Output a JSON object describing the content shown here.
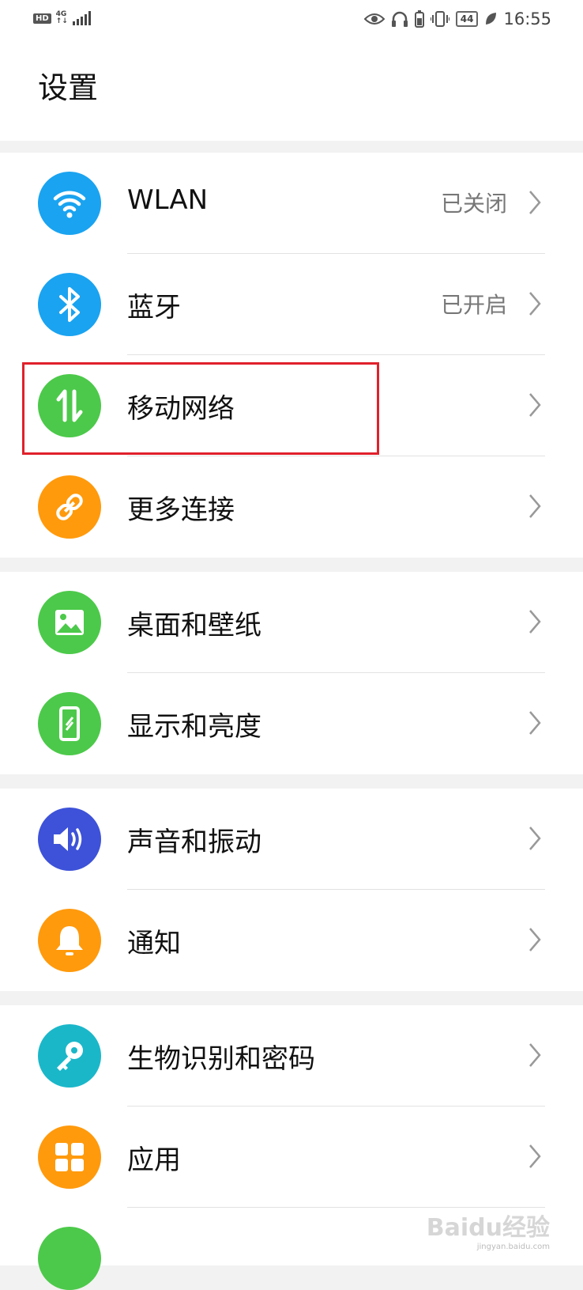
{
  "status_bar": {
    "hd_label": "HD",
    "network_label": "4G",
    "network_sub": "↑↓",
    "battery_level": "44",
    "time": "16:55"
  },
  "header": {
    "title": "设置"
  },
  "colors": {
    "wlan": "#1aa3f0",
    "bluetooth": "#1aa3f0",
    "mobile_network": "#4cc94a",
    "more_connections": "#ff9a0c",
    "wallpaper": "#4cc94a",
    "display": "#4cc94a",
    "sound": "#3d52d8",
    "notifications": "#ff9a0c",
    "biometrics": "#1ab7c9",
    "apps": "#ff9a0c",
    "highlight_box": "#e0212b"
  },
  "groups": [
    {
      "items": [
        {
          "label": "WLAN",
          "value": "已关闭",
          "icon": "wifi-icon"
        },
        {
          "label": "蓝牙",
          "value": "已开启",
          "icon": "bluetooth-icon"
        },
        {
          "label": "移动网络",
          "value": "",
          "icon": "mobile-data-icon"
        },
        {
          "label": "更多连接",
          "value": "",
          "icon": "link-icon"
        }
      ]
    },
    {
      "items": [
        {
          "label": "桌面和壁纸",
          "value": "",
          "icon": "wallpaper-icon"
        },
        {
          "label": "显示和亮度",
          "value": "",
          "icon": "display-icon"
        }
      ]
    },
    {
      "items": [
        {
          "label": "声音和振动",
          "value": "",
          "icon": "speaker-icon"
        },
        {
          "label": "通知",
          "value": "",
          "icon": "bell-icon"
        }
      ]
    },
    {
      "items": [
        {
          "label": "生物识别和密码",
          "value": "",
          "icon": "key-icon"
        },
        {
          "label": "应用",
          "value": "",
          "icon": "apps-grid-icon"
        }
      ]
    }
  ],
  "watermark": {
    "text": "Baidu经验",
    "sub": "jingyan.baidu.com"
  }
}
